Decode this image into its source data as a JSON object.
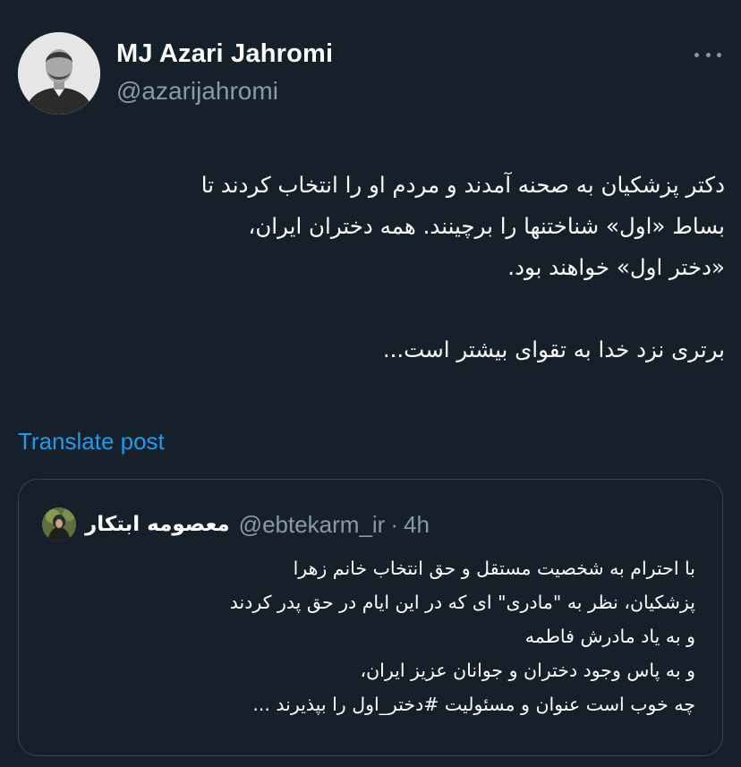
{
  "tweet": {
    "author_name": "MJ Azari Jahromi",
    "author_handle": "@azarijahromi",
    "more_icon": "more-horizontal-icon",
    "text_lines": [
      "دکتر پزشکیان به صحنه آمدند و مردم او را انتخاب کردند تا",
      "بساط «اول» شناختنها را برچینند. همه دختران ایران،",
      "«دختر اول» خواهند بود.",
      "برتری نزد خدا به تقوای بیشتر است..."
    ],
    "translate_label": "Translate post"
  },
  "quote": {
    "author_name": "معصومه ابتکار",
    "author_handle": "@ebtekarm_ir",
    "separator": "·",
    "time": "4h",
    "text_lines": [
      "با احترام به شخصیت مستقل و حق انتخاب خانم زهرا",
      "پزشکیان، نظر به \"مادری\" ای که در این ایام در حق پدر کردند",
      "و به یاد مادرش فاطمه",
      "و به پاس وجود دختران و جوانان عزیز ایران،",
      "چه خوب است عنوان و مسئولیت #دختر_اول را بپذیرند ..."
    ]
  },
  "colors": {
    "background": "#15202b",
    "primary_text": "#ffffff",
    "secondary_text": "#8b98a5",
    "link": "#1d9bf0",
    "border": "#38444d"
  }
}
